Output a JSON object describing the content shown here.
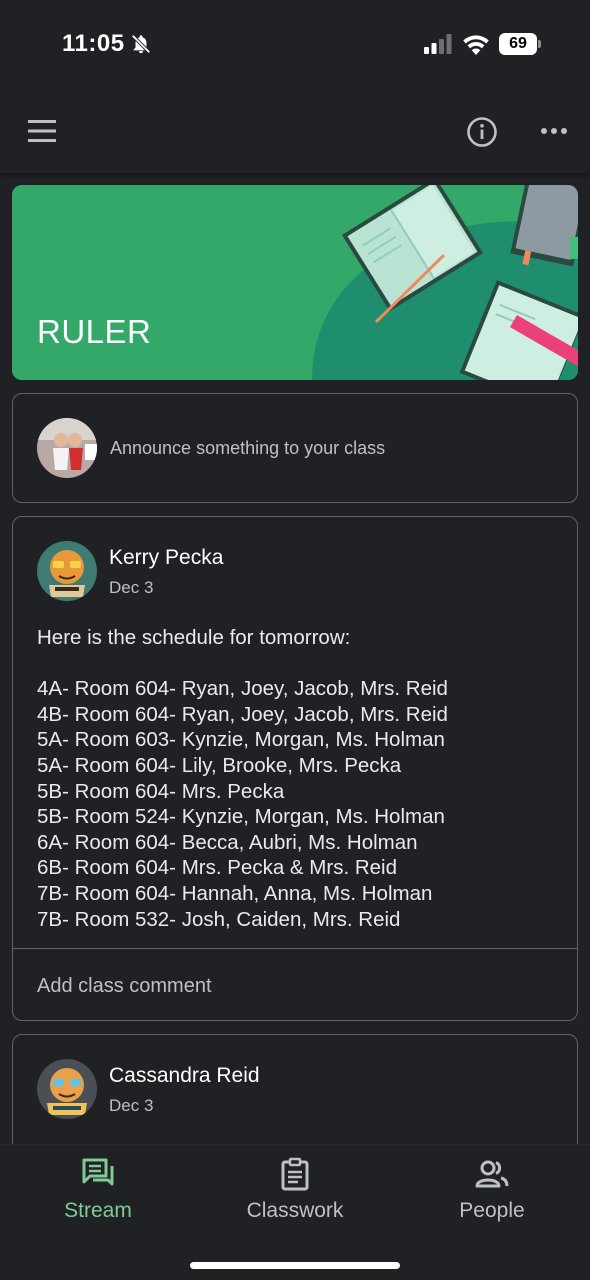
{
  "status_bar": {
    "time": "11:05",
    "battery": "69",
    "icons": [
      "bell-off-icon",
      "signal-icon",
      "wifi-icon",
      "battery-icon"
    ]
  },
  "app_bar": {
    "icons": [
      "menu-icon",
      "info-icon",
      "more-horizontal-icon"
    ]
  },
  "banner": {
    "title": "RULER",
    "color": "#34a869"
  },
  "announce": {
    "placeholder": "Announce something to your class"
  },
  "posts": [
    {
      "author": "Kerry Pecka",
      "date": "Dec 3",
      "intro": "Here is the schedule for tomorrow:",
      "lines": [
        "4A- Room 604- Ryan, Joey, Jacob, Mrs. Reid",
        "4B- Room 604- Ryan, Joey, Jacob, Mrs. Reid",
        "5A- Room 603- Kynzie, Morgan, Ms. Holman",
        "5A- Room 604- Lily, Brooke, Mrs. Pecka",
        "5B- Room 604- Mrs. Pecka",
        "5B- Room 524- Kynzie, Morgan, Ms. Holman",
        "6A- Room 604- Becca, Aubri, Ms. Holman",
        "6B- Room 604- Mrs. Pecka & Mrs. Reid",
        "7B- Room 604- Hannah, Anna, Ms. Holman",
        "7B- Room 532- Josh, Caiden, Mrs. Reid"
      ],
      "comment_label": "Add class comment"
    },
    {
      "author": "Cassandra Reid",
      "date": "Dec 3"
    }
  ],
  "bottom_nav": {
    "items": [
      {
        "label": "Stream",
        "icon": "stream-icon",
        "active": true
      },
      {
        "label": "Classwork",
        "icon": "classwork-icon",
        "active": false
      },
      {
        "label": "People",
        "icon": "people-icon",
        "active": false
      }
    ],
    "active_color": "#81c995"
  }
}
